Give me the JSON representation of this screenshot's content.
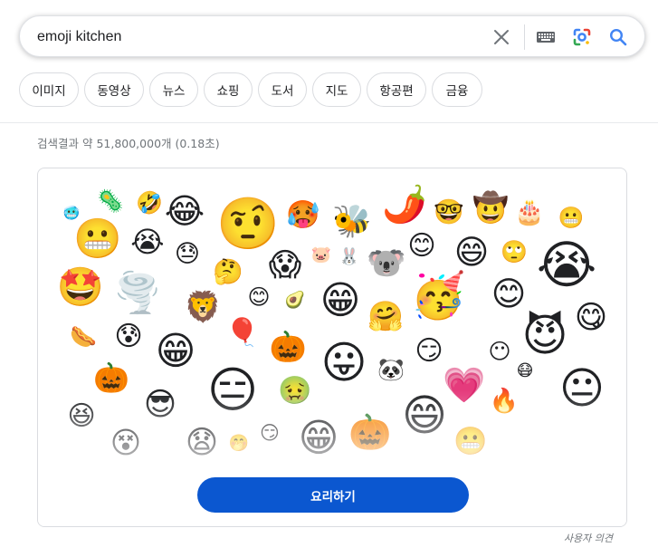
{
  "search": {
    "query": "emoji kitchen",
    "icons": {
      "clear": "close-icon",
      "keyboard": "keyboard-icon",
      "lens": "google-lens-icon",
      "search": "search-icon"
    },
    "colors": {
      "accent": "#4285f4",
      "lens_red": "#ea4335",
      "lens_yellow": "#fbbc04",
      "lens_green": "#34a853"
    }
  },
  "chips": [
    "이미지",
    "동영상",
    "뉴스",
    "쇼핑",
    "도서",
    "지도",
    "항공편",
    "금융"
  ],
  "result_stats": "검색결과 약 51,800,000개 (0.18초)",
  "emoji_card": {
    "emojis": [
      "🥶",
      "🦠",
      "🤣",
      "😂",
      "🤨",
      "🥵",
      "🐝",
      "🌶️",
      "🤓",
      "🤠",
      "🎂",
      "😬",
      "😬",
      "😭",
      "😓",
      "🤔",
      "😱",
      "🐷",
      "🐰",
      "🐨",
      "😊",
      "😄",
      "🙄",
      "😭",
      "🤩",
      "🌪️",
      "🦁",
      "😊",
      "🥑",
      "😁",
      "🤗",
      "🥳",
      "😊",
      "😋",
      "🌭",
      "😰",
      "😁",
      "🎈",
      "🎃",
      "😛",
      "😏",
      "😶",
      "😈",
      "🎃",
      "😎",
      "😑",
      "🤢",
      "🐼",
      "💗",
      "🔥",
      "😷",
      "😐",
      "😆",
      "😵",
      "😧",
      "🤭",
      "😏",
      "😁",
      "🎃",
      "😄",
      "😬"
    ],
    "button_label": "요리하기",
    "button_color": "#0b57d0"
  },
  "feedback_label": "사용자 의견"
}
